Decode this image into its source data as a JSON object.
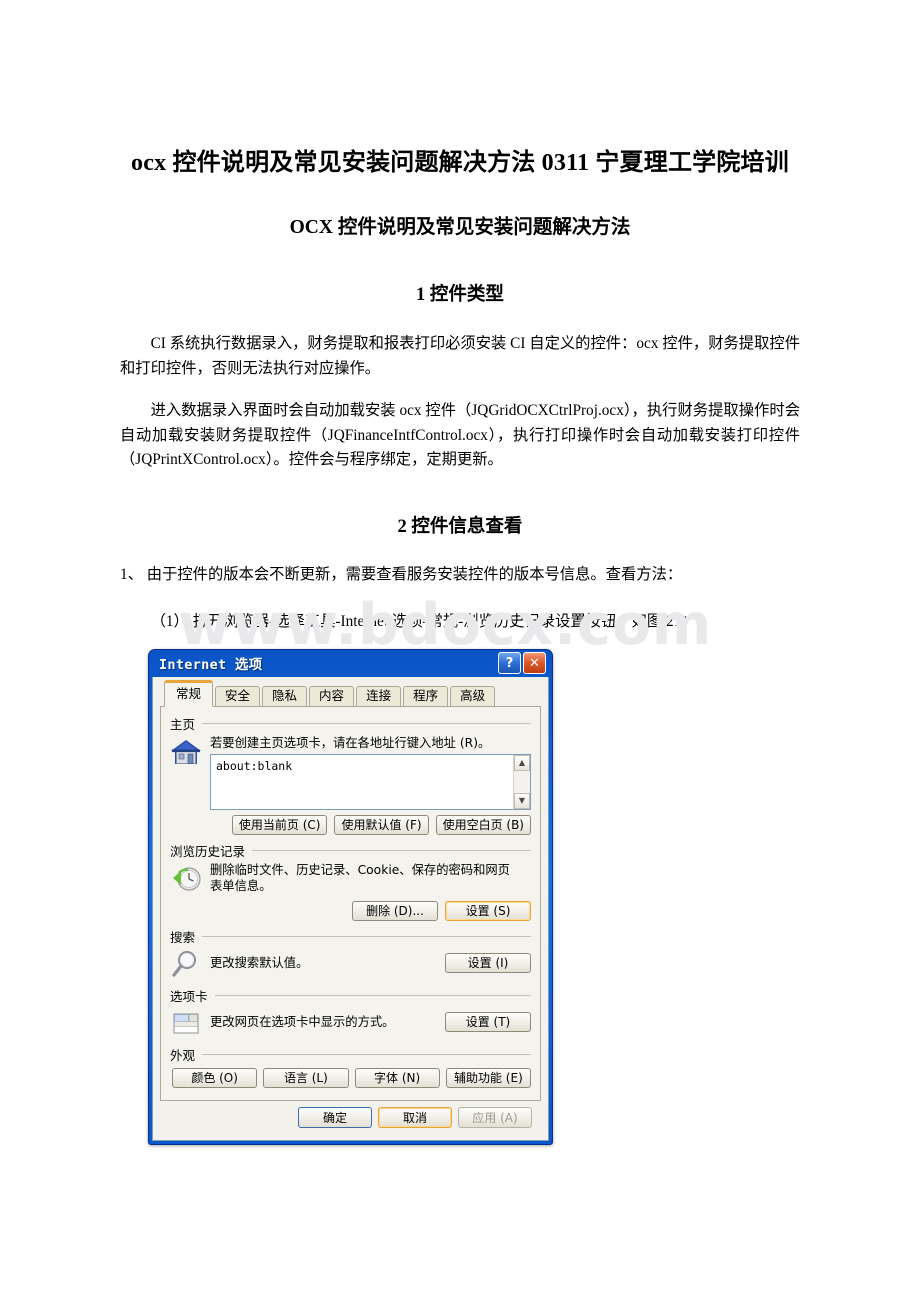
{
  "document": {
    "title": "ocx 控件说明及常见安装问题解决方法 0311 宁夏理工学院培训",
    "subtitle": "OCX 控件说明及常见安装问题解决方法",
    "section1_heading": "1 控件类型",
    "para1": "CI 系统执行数据录入，财务提取和报表打印必须安装 CI 自定义的控件：ocx 控件，财务提取控件和打印控件，否则无法执行对应操作。",
    "para2": "进入数据录入界面时会自动加载安装 ocx 控件（JQGridOCXCtrlProj.ocx），执行财务提取操作时会自动加载安装财务提取控件（JQFinanceIntfControl.ocx），执行打印操作时会自动加载安装打印控件（JQPrintXControl.ocx）。控件会与程序绑定，定期更新。",
    "section2_heading": "2 控件信息查看",
    "para3": "1、 由于控件的版本会不断更新，需要查看服务安装控件的版本号信息。查看方法：",
    "para4": "（1） 打开浏览器-选择工具-Internet 选项-常规-浏览历史记录设置按钮，如图 21："
  },
  "watermark": {
    "text": "www.bdocx.com",
    "color": "#e9e9ec"
  },
  "dialog": {
    "title": "Internet 选项",
    "titlebar_color": "#1470e2",
    "help_button": "?",
    "close_button": "✕",
    "tabs": [
      {
        "label": "常规",
        "active": true
      },
      {
        "label": "安全",
        "active": false
      },
      {
        "label": "隐私",
        "active": false
      },
      {
        "label": "内容",
        "active": false
      },
      {
        "label": "连接",
        "active": false
      },
      {
        "label": "程序",
        "active": false
      },
      {
        "label": "高级",
        "active": false
      }
    ],
    "active_tab_accent": "#e8a33d",
    "groups": {
      "home": {
        "title": "主页",
        "icon": "house-icon",
        "description": "若要创建主页选项卡，请在各地址行键入地址 (R)。",
        "address_value": "about:blank",
        "buttons": [
          {
            "label": "使用当前页 (C)"
          },
          {
            "label": "使用默认值 (F)"
          },
          {
            "label": "使用空白页 (B)"
          }
        ]
      },
      "history": {
        "title": "浏览历史记录",
        "icon": "clock-refresh-icon",
        "description_line1": "删除临时文件、历史记录、Cookie、保存的密码和网页",
        "description_line2": "表单信息。",
        "buttons": [
          {
            "label": "删除 (D)..."
          },
          {
            "label": "设置 (S)"
          }
        ]
      },
      "search": {
        "title": "搜索",
        "icon": "magnifier-icon",
        "description": "更改搜索默认值。",
        "button": "设置 (I)"
      },
      "tabs_group": {
        "title": "选项卡",
        "icon": "tabs-icon",
        "description": "更改网页在选项卡中显示的方式。",
        "button": "设置 (T)"
      },
      "appearance": {
        "title": "外观",
        "buttons": [
          {
            "label": "颜色 (O)"
          },
          {
            "label": "语言 (L)"
          },
          {
            "label": "字体 (N)"
          },
          {
            "label": "辅助功能 (E)"
          }
        ]
      }
    },
    "footer": {
      "ok": "确定",
      "cancel": "取消",
      "apply": "应用 (A)",
      "apply_disabled": true,
      "cancel_focused": true
    }
  }
}
